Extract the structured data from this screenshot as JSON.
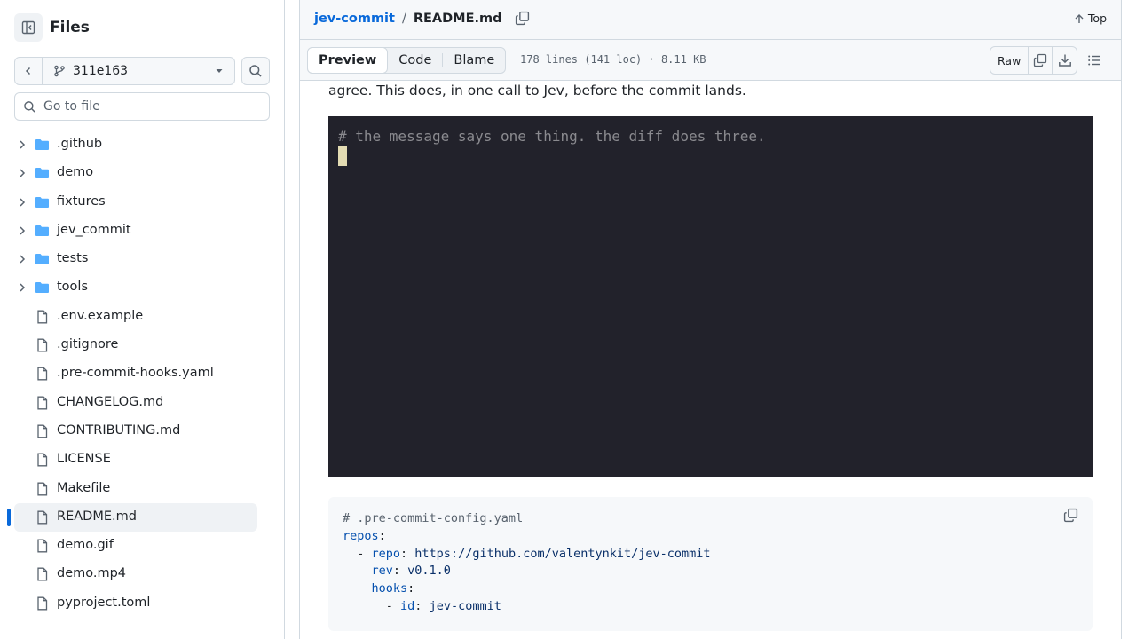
{
  "sidebar": {
    "title": "Files",
    "branch": "311e163",
    "goto_placeholder": "Go to file",
    "items": [
      {
        "label": ".github",
        "type": "folder"
      },
      {
        "label": "demo",
        "type": "folder"
      },
      {
        "label": "fixtures",
        "type": "folder"
      },
      {
        "label": "jev_commit",
        "type": "folder"
      },
      {
        "label": "tests",
        "type": "folder"
      },
      {
        "label": "tools",
        "type": "folder"
      },
      {
        "label": ".env.example",
        "type": "file"
      },
      {
        "label": ".gitignore",
        "type": "file"
      },
      {
        "label": ".pre-commit-hooks.yaml",
        "type": "file"
      },
      {
        "label": "CHANGELOG.md",
        "type": "file"
      },
      {
        "label": "CONTRIBUTING.md",
        "type": "file"
      },
      {
        "label": "LICENSE",
        "type": "file"
      },
      {
        "label": "Makefile",
        "type": "file"
      },
      {
        "label": "README.md",
        "type": "file",
        "selected": true
      },
      {
        "label": "demo.gif",
        "type": "file"
      },
      {
        "label": "demo.mp4",
        "type": "file"
      },
      {
        "label": "pyproject.toml",
        "type": "file"
      }
    ]
  },
  "header": {
    "repo": "jev-commit",
    "separator": "/",
    "file": "README.md",
    "top_label": "Top"
  },
  "toolbar": {
    "tabs": [
      "Preview",
      "Code",
      "Blame"
    ],
    "active_tab": "Preview",
    "meta": "178 lines (141 loc) · 8.11 KB",
    "raw_label": "Raw"
  },
  "content": {
    "paragraph": "agree. This does, in one call to Jev, before the commit lands.",
    "terminal_line": "# the message says one thing. the diff does three.",
    "code": {
      "comment": "# .pre-commit-config.yaml",
      "repos_key": "repos",
      "repo_key": "repo",
      "repo_url": "https://github.com/valentynkit/jev-commit",
      "rev_key": "rev",
      "rev_val": "v0.1.0",
      "hooks_key": "hooks",
      "id_key": "id",
      "id_val": "jev-commit"
    }
  },
  "colors": {
    "accent": "#0969da",
    "folder": "#54aeff",
    "terminal_bg": "#22222b"
  }
}
